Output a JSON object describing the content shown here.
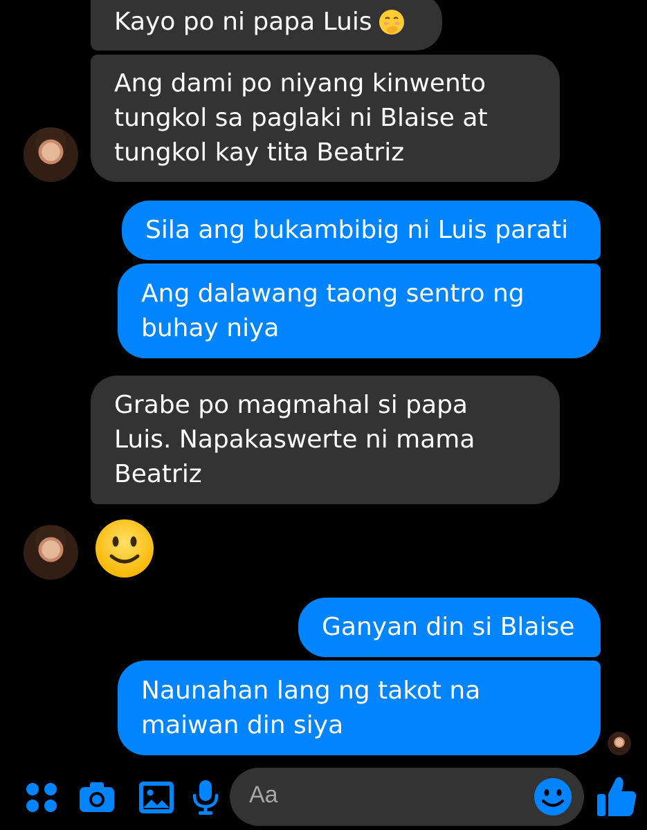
{
  "messages": [
    {
      "side": "in",
      "text": "Kayo po ni papa Luis",
      "trailing_emoji": "hand-over-mouth-emoji"
    },
    {
      "side": "in",
      "text": "Ang dami po niyang kinwento\ntungkol sa paglaki ni Blaise at\ntungkol kay tita Beatriz"
    },
    {
      "side": "out",
      "text": "Sila ang bukambibig ni Luis parati"
    },
    {
      "side": "out",
      "text": "Ang dalawang taong sentro ng\nbuhay niya"
    },
    {
      "side": "in",
      "text": "Grabe po magmahal si papa\nLuis. Napakaswerte ni mama\nBeatriz"
    },
    {
      "side": "in",
      "emoji": "slightly-smiling-face-emoji"
    },
    {
      "side": "out",
      "text": "Ganyan din si Blaise"
    },
    {
      "side": "out",
      "text": "Naunahan lang ng takot na\nmaiwan din siya"
    }
  ],
  "composer": {
    "placeholder": "Aa"
  },
  "toolbar": {
    "icons": [
      "apps-icon",
      "camera-icon",
      "gallery-icon",
      "microphone-icon",
      "emoji-icon",
      "thumbs-up-icon"
    ]
  },
  "colors": {
    "background": "#000000",
    "incoming_bubble": "#333333",
    "outgoing_bubble": "#0084ff",
    "accent": "#0084ff",
    "text": "#ffffff",
    "placeholder": "#a7a7a7"
  }
}
